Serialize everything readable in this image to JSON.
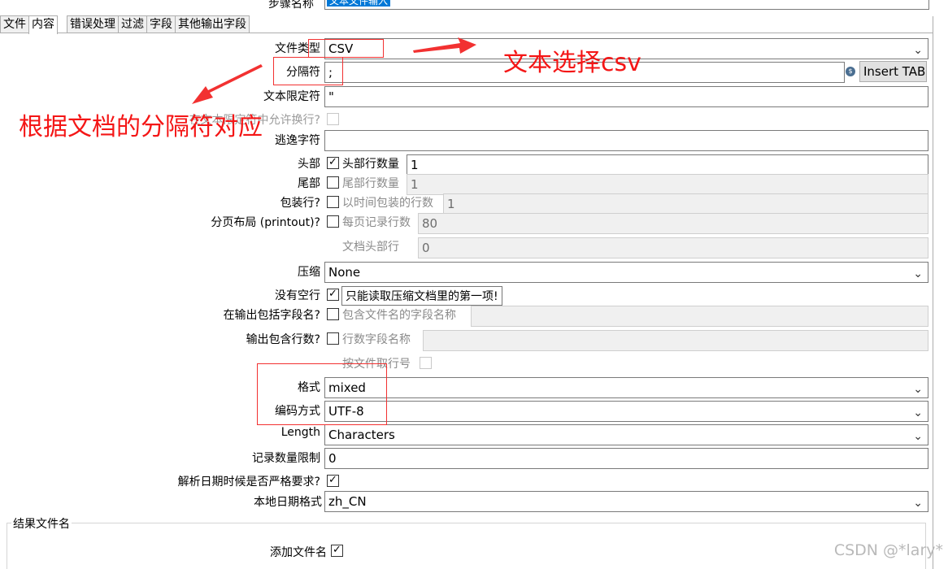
{
  "step": {
    "label": "步骤名称",
    "value": "文本文件输入"
  },
  "tabs": [
    "文件",
    "内容",
    "错误处理",
    "过滤",
    "字段",
    "其他输出字段"
  ],
  "fields": {
    "filetype": {
      "label": "文件类型",
      "value": "CSV"
    },
    "separator": {
      "label": "分隔符",
      "value": ";"
    },
    "insert_tab": "Insert TAB",
    "enclosure": {
      "label": "文本限定符",
      "value": "\""
    },
    "break_in_enclosure": {
      "label": "在文本限定符中允许换行?"
    },
    "escape": {
      "label": "逃逸字符",
      "value": ""
    },
    "header": {
      "label": "头部",
      "sub_label": "头部行数量",
      "value": "1",
      "checked": true
    },
    "footer": {
      "label": "尾部",
      "sub_label": "尾部行数量",
      "value": "1",
      "checked": false
    },
    "wrapped": {
      "label": "包装行?",
      "sub_label": "以时间包装的行数",
      "value": "1",
      "checked": false
    },
    "paged": {
      "label": "分页布局 (printout)?",
      "sub_label": "每页记录行数",
      "value": "80",
      "checked": false
    },
    "doc_header": {
      "sub_label": "文档头部行",
      "value": "0"
    },
    "compression": {
      "label": "压缩",
      "value": "None"
    },
    "no_empty": {
      "label": "没有空行",
      "checked": true,
      "tooltip": "只能读取压缩文档里的第一项!"
    },
    "include_filename": {
      "label": "在输出包括字段名?",
      "sub_label": "包含文件名的字段名称",
      "checked": false
    },
    "include_rownum": {
      "label": "输出包含行数?",
      "sub_label": "行数字段名称",
      "checked": false
    },
    "rownum_by_file": {
      "label": "按文件取行号"
    },
    "format": {
      "label": "格式",
      "value": "mixed"
    },
    "encoding": {
      "label": "编码方式",
      "value": "UTF-8"
    },
    "length": {
      "label": "Length",
      "value": "Characters"
    },
    "limit": {
      "label": "记录数量限制",
      "value": "0"
    },
    "date_strict": {
      "label": "解析日期时候是否严格要求?",
      "checked": true
    },
    "locale": {
      "label": "本地日期格式",
      "value": "zh_CN"
    }
  },
  "result_group": {
    "title": "结果文件名",
    "add_filename_label": "添加文件名",
    "checked": true
  },
  "annotations": {
    "csv_note": "文本选择csv",
    "separator_note": "根据文档的分隔符对应",
    "color": "#f41616"
  },
  "watermark": "CSDN @*lary*",
  "icons": {
    "dropdown": "chevron-down-icon",
    "check": "check-icon",
    "variable": "variable-icon"
  }
}
